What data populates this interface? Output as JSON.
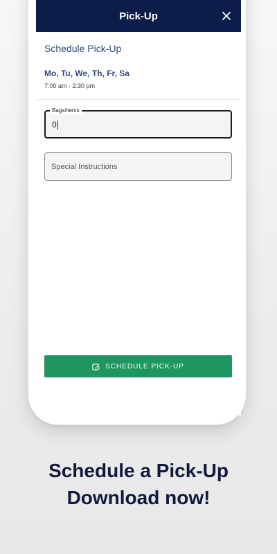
{
  "header": {
    "title": "Pick-Up"
  },
  "schedule": {
    "title": "Schedule Pick-Up",
    "days": "Mo, Tu, We, Th, Fr, Sa",
    "hours": "7:00 am - 2:30 pm"
  },
  "bags_field": {
    "label": "Bags/items",
    "value": "0"
  },
  "instructions_field": {
    "placeholder": "Special Instructions"
  },
  "cta": {
    "label": "SCHEDULE PICK-UP",
    "icon": "calendar-clock-icon"
  },
  "promo": {
    "line1": "Schedule a Pick-Up",
    "line2": "Download now!"
  },
  "colors": {
    "header_bg": "#0d1d4a",
    "accent_text": "#2b4a7a",
    "button_green": "#1f9560",
    "promo_text": "#111a3d"
  }
}
